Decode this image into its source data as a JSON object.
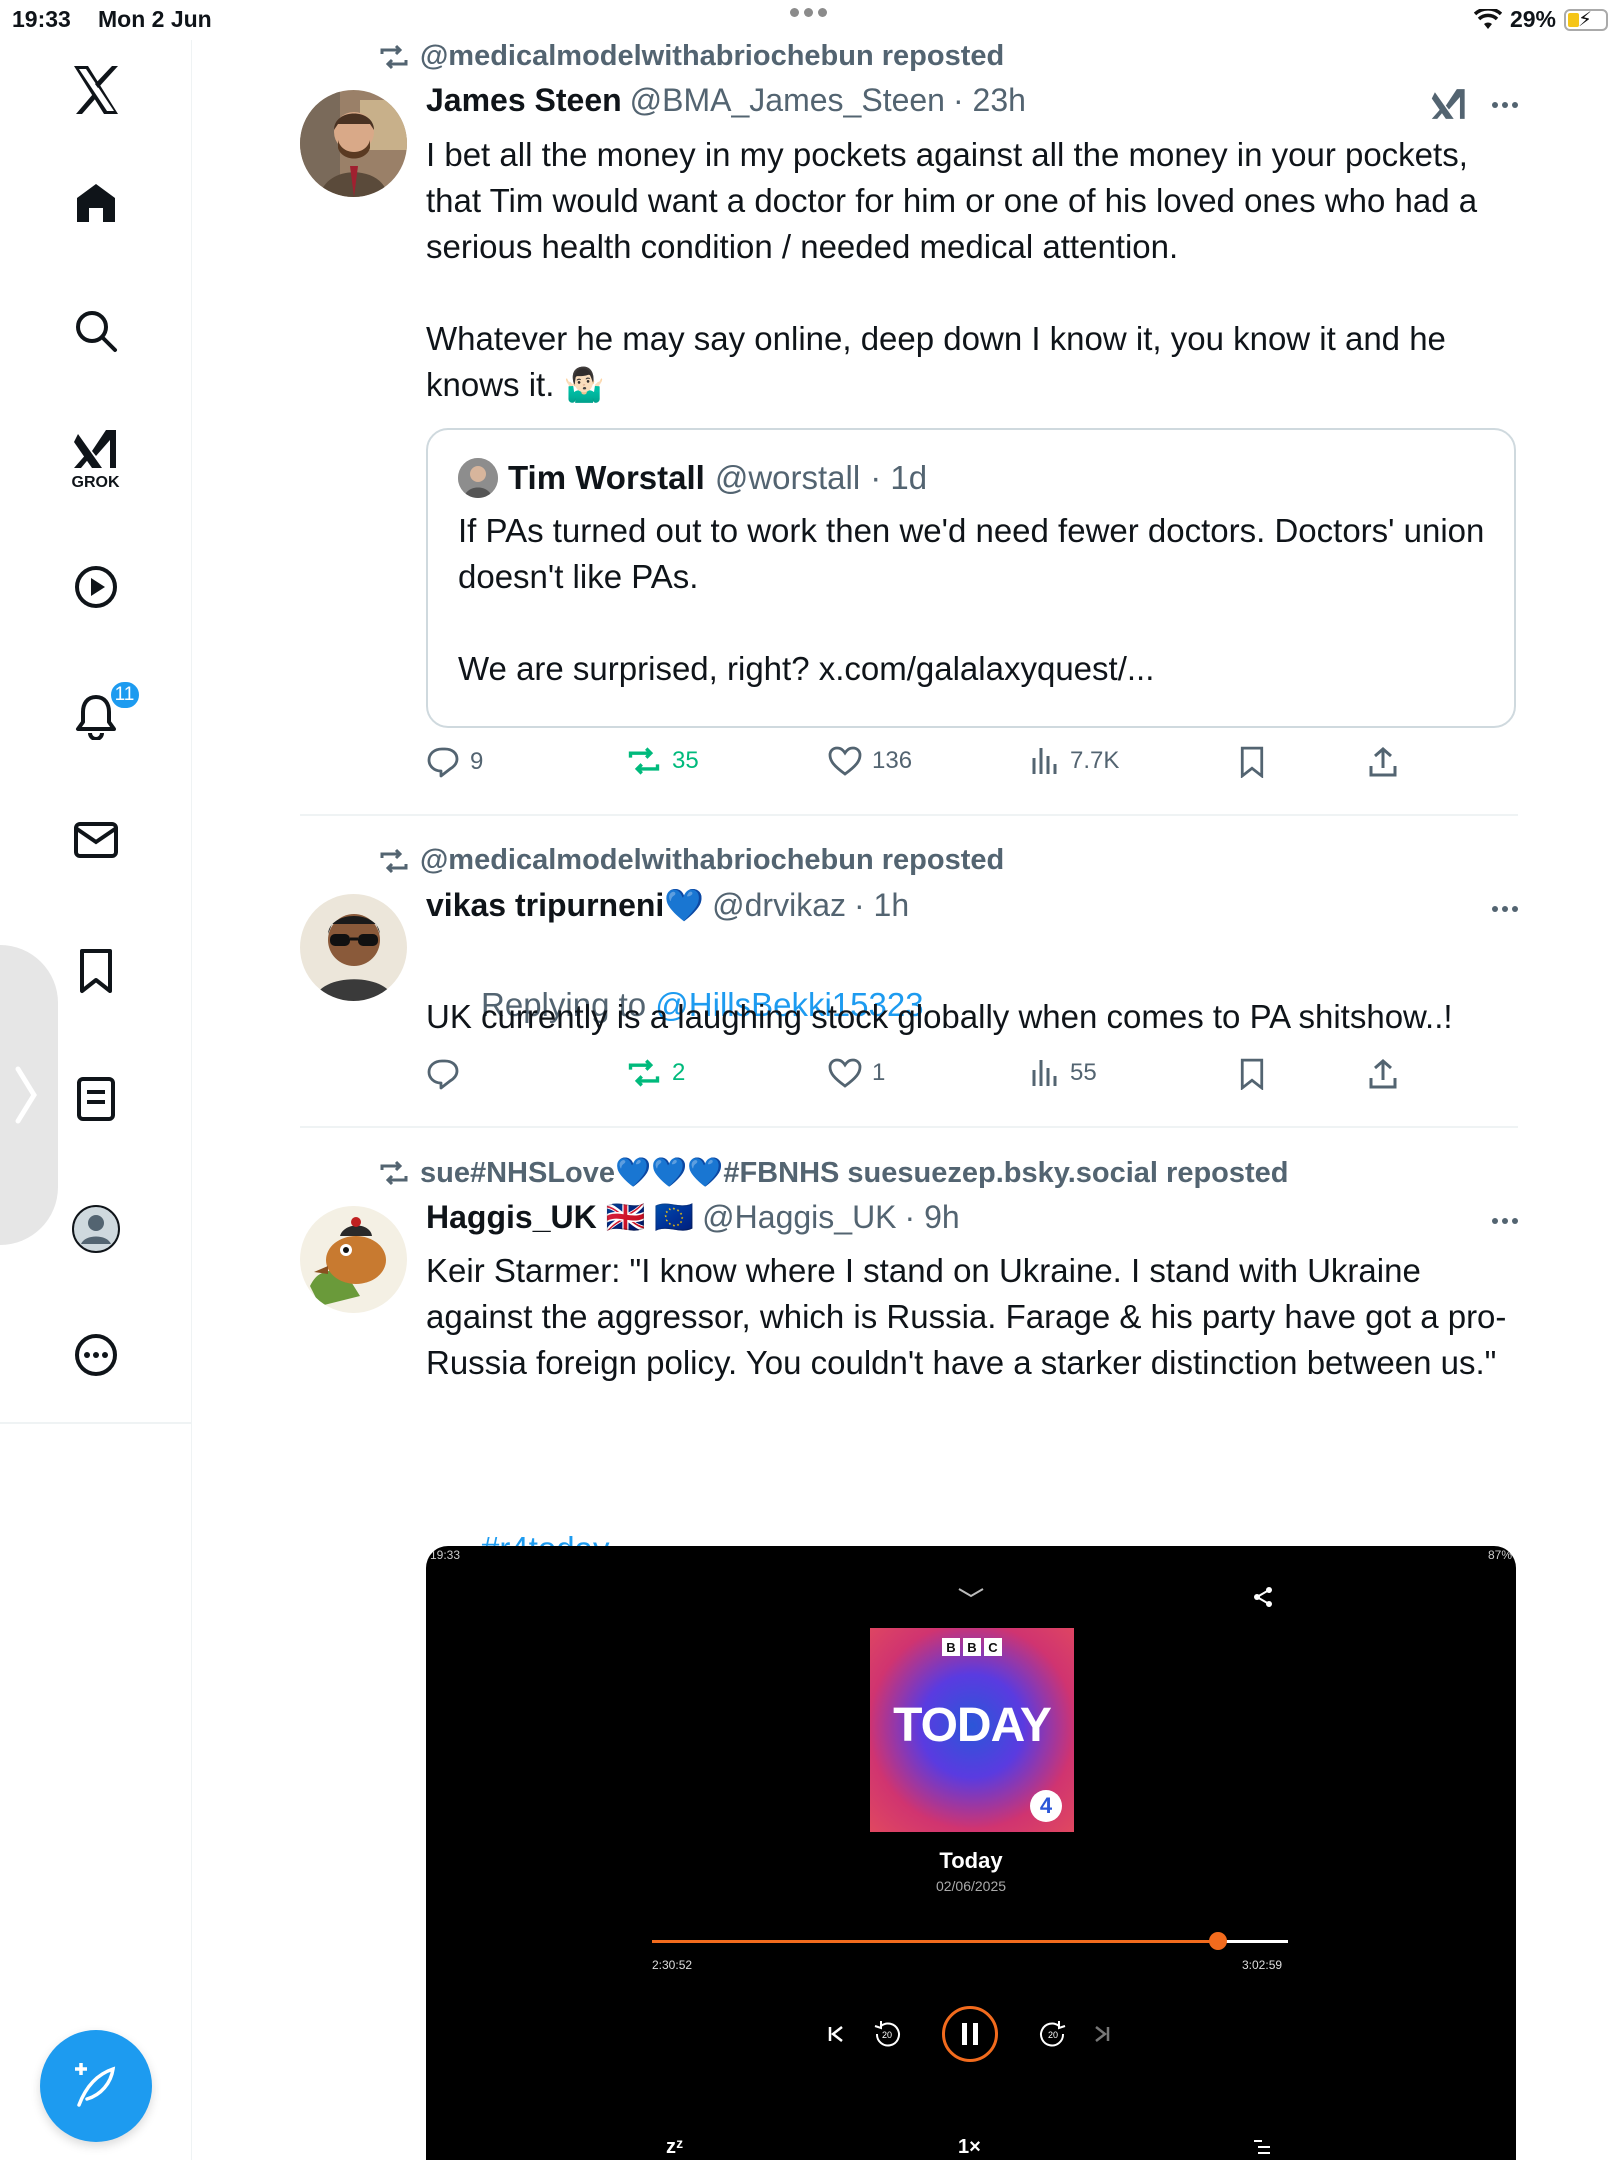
{
  "status_bar": {
    "time": "19:33",
    "date": "Mon 2 Jun",
    "battery": "29%"
  },
  "sidebar": {
    "grok_label": "GROK",
    "notifications_badge": "11"
  },
  "posts": [
    {
      "repost_by": "@medicalmodelwithabriochebun reposted",
      "name": "James Steen",
      "handle": "@BMA_James_Steen",
      "time": "· 23h",
      "text": "I bet all the money in my pockets against all the money in your pockets, that Tim would want a doctor for him or one of his loved ones who had a serious health condition / needed medical attention.\n\nWhatever he may say online, deep down I know it, you know it and he knows it. 🤷🏻‍♂️",
      "quote": {
        "name": "Tim Worstall",
        "handle": "@worstall",
        "time": "· 1d",
        "text": "If PAs turned out to work then we'd need fewer doctors. Doctors' union doesn't like PAs.\n\nWe are surprised, right? x.com/galalaxyquest/..."
      },
      "stats": {
        "replies": "9",
        "reposts": "35",
        "likes": "136",
        "views": "7.7K"
      }
    },
    {
      "repost_by": "@medicalmodelwithabriochebun reposted",
      "name": "vikas tripurneni💙",
      "handle": "@drvikaz",
      "time": "· 1h",
      "replying_prefix": "Replying to ",
      "replying_to": "@HillsBekki15323",
      "text": "UK currently is a laughing stock globally when comes to PA shitshow..!",
      "stats": {
        "replies": "",
        "reposts": "2",
        "likes": "1",
        "views": "55"
      }
    },
    {
      "repost_by": "sue#NHSLove💙💙💙#FBNHS suesuezep.bsky.social reposted",
      "name": "Haggis_UK 🇬🇧 🇪🇺",
      "handle": "@Haggis_UK",
      "time": "· 9h",
      "text": "Keir Starmer: \"I know where I stand on Ukraine. I stand with Ukraine against the aggressor, which is Russia. Farage & his party have got a pro-Russia foreign policy. You couldn't have a starker distinction between us.\"",
      "hashtag": "#r4today",
      "media": {
        "status_time": "19:33",
        "status_battery": "87%",
        "brand": [
          "B",
          "B",
          "C"
        ],
        "art_title": "TODAY",
        "art_badge": "4",
        "title": "Today",
        "date": "02/06/2025",
        "elapsed": "2:30:52",
        "duration": "3:02:59",
        "progress_fraction": 0.89,
        "rewind_label": "20",
        "forward_label": "20",
        "sleep_label": "zᶻ",
        "speed_label": "1×"
      }
    }
  ],
  "colors": {
    "accent": "#1d9bf0",
    "repost_green": "#00ba7c",
    "muted": "#536471",
    "player_orange": "#f26b1d"
  }
}
